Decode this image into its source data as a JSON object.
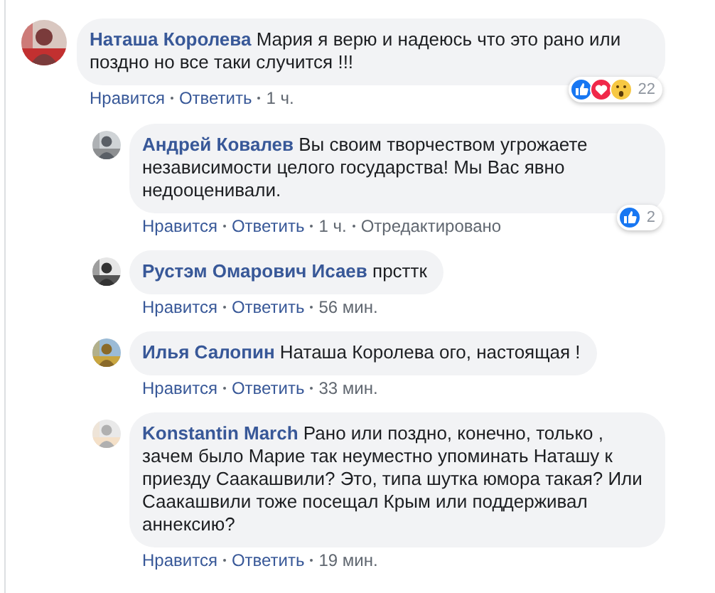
{
  "comments": [
    {
      "author": "Наташа Королева",
      "text": "Мария я верю и надеюсь что это рано или поздно но все таки случится !!!",
      "avatar": {
        "kind": "picture"
      },
      "reply": false,
      "actions": [
        "Нравится",
        "Ответить",
        "1 ч."
      ],
      "reactions": {
        "icons": [
          {
            "kind": "like"
          },
          {
            "kind": "love"
          },
          {
            "kind": "wow"
          }
        ],
        "count": "22"
      }
    },
    {
      "author": "Андрей Ковалев",
      "text": "Вы своим творчеством угрожаете независимости целого государства! Мы Вас явно недооценивали.",
      "avatar": {
        "kind": "picture"
      },
      "reply": true,
      "actions": [
        "Нравится",
        "Ответить",
        "1 ч.",
        "Отредактировано"
      ],
      "reactions": {
        "icons": [
          {
            "kind": "like"
          }
        ],
        "count": "2"
      }
    },
    {
      "author": "Рустэм Омарович Исаев",
      "text": "прсттк",
      "avatar": {
        "kind": "picture"
      },
      "reply": true,
      "actions": [
        "Нравится",
        "Ответить",
        "56 мин."
      ]
    },
    {
      "author": "Илья Салопин",
      "text": "Наташа Королева ого, настоящая !",
      "avatar": {
        "kind": "picture"
      },
      "reply": true,
      "actions": [
        "Нравится",
        "Ответить",
        "33 мин."
      ]
    },
    {
      "author": "Konstantin March",
      "text": "Рано или поздно, конечно, только , зачем было Марие так неуместно упоминать Наташу к приезду Саакашвили? Это, типа шутка юмора такая? Или Саакашвили тоже посещал Крым или поддерживал аннексию?",
      "avatar": {
        "kind": "picture"
      },
      "reply": true,
      "actions": [
        "Нравится",
        "Ответить",
        "19 мин."
      ]
    }
  ]
}
